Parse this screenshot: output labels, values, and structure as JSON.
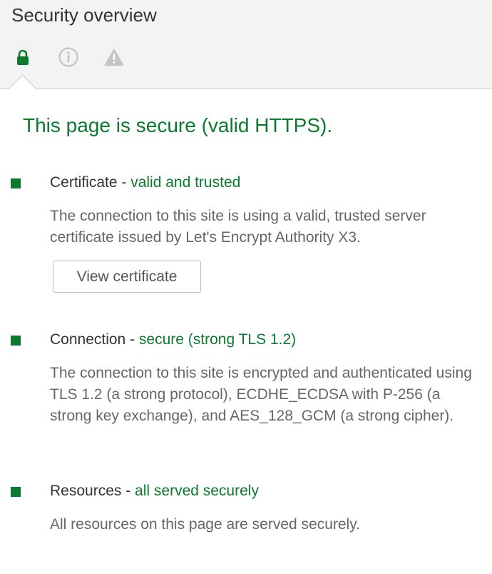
{
  "panel": {
    "title": "Security overview"
  },
  "tabs": [
    {
      "icon": "lock-icon",
      "color": "#0b7a2f",
      "active": true
    },
    {
      "icon": "info-icon",
      "color": "#c4c4c4",
      "active": false
    },
    {
      "icon": "warning-icon",
      "color": "#c4c4c4",
      "active": false
    }
  ],
  "summary": {
    "text": "This page is secure (valid HTTPS).",
    "color": "#0b7a2f"
  },
  "sections": {
    "certificate": {
      "title": "Certificate - ",
      "status": "valid and trusted",
      "description": "The connection to this site is using a valid, trusted server certificate issued by Let's Encrypt Authority X3.",
      "button_label": "View certificate"
    },
    "connection": {
      "title": "Connection - ",
      "status": "secure (strong TLS 1.2)",
      "description": "The connection to this site is encrypted and authenticated using TLS 1.2 (a strong protocol), ECDHE_ECDSA with P-256 (a strong key exchange), and AES_128_GCM (a strong cipher)."
    },
    "resources": {
      "title": "Resources - ",
      "status": "all served securely",
      "description": "All resources on this page are served securely."
    }
  },
  "colors": {
    "secure_green": "#0b7a2f",
    "header_background": "#f3f3f3",
    "muted_icon": "#c4c4c4"
  }
}
